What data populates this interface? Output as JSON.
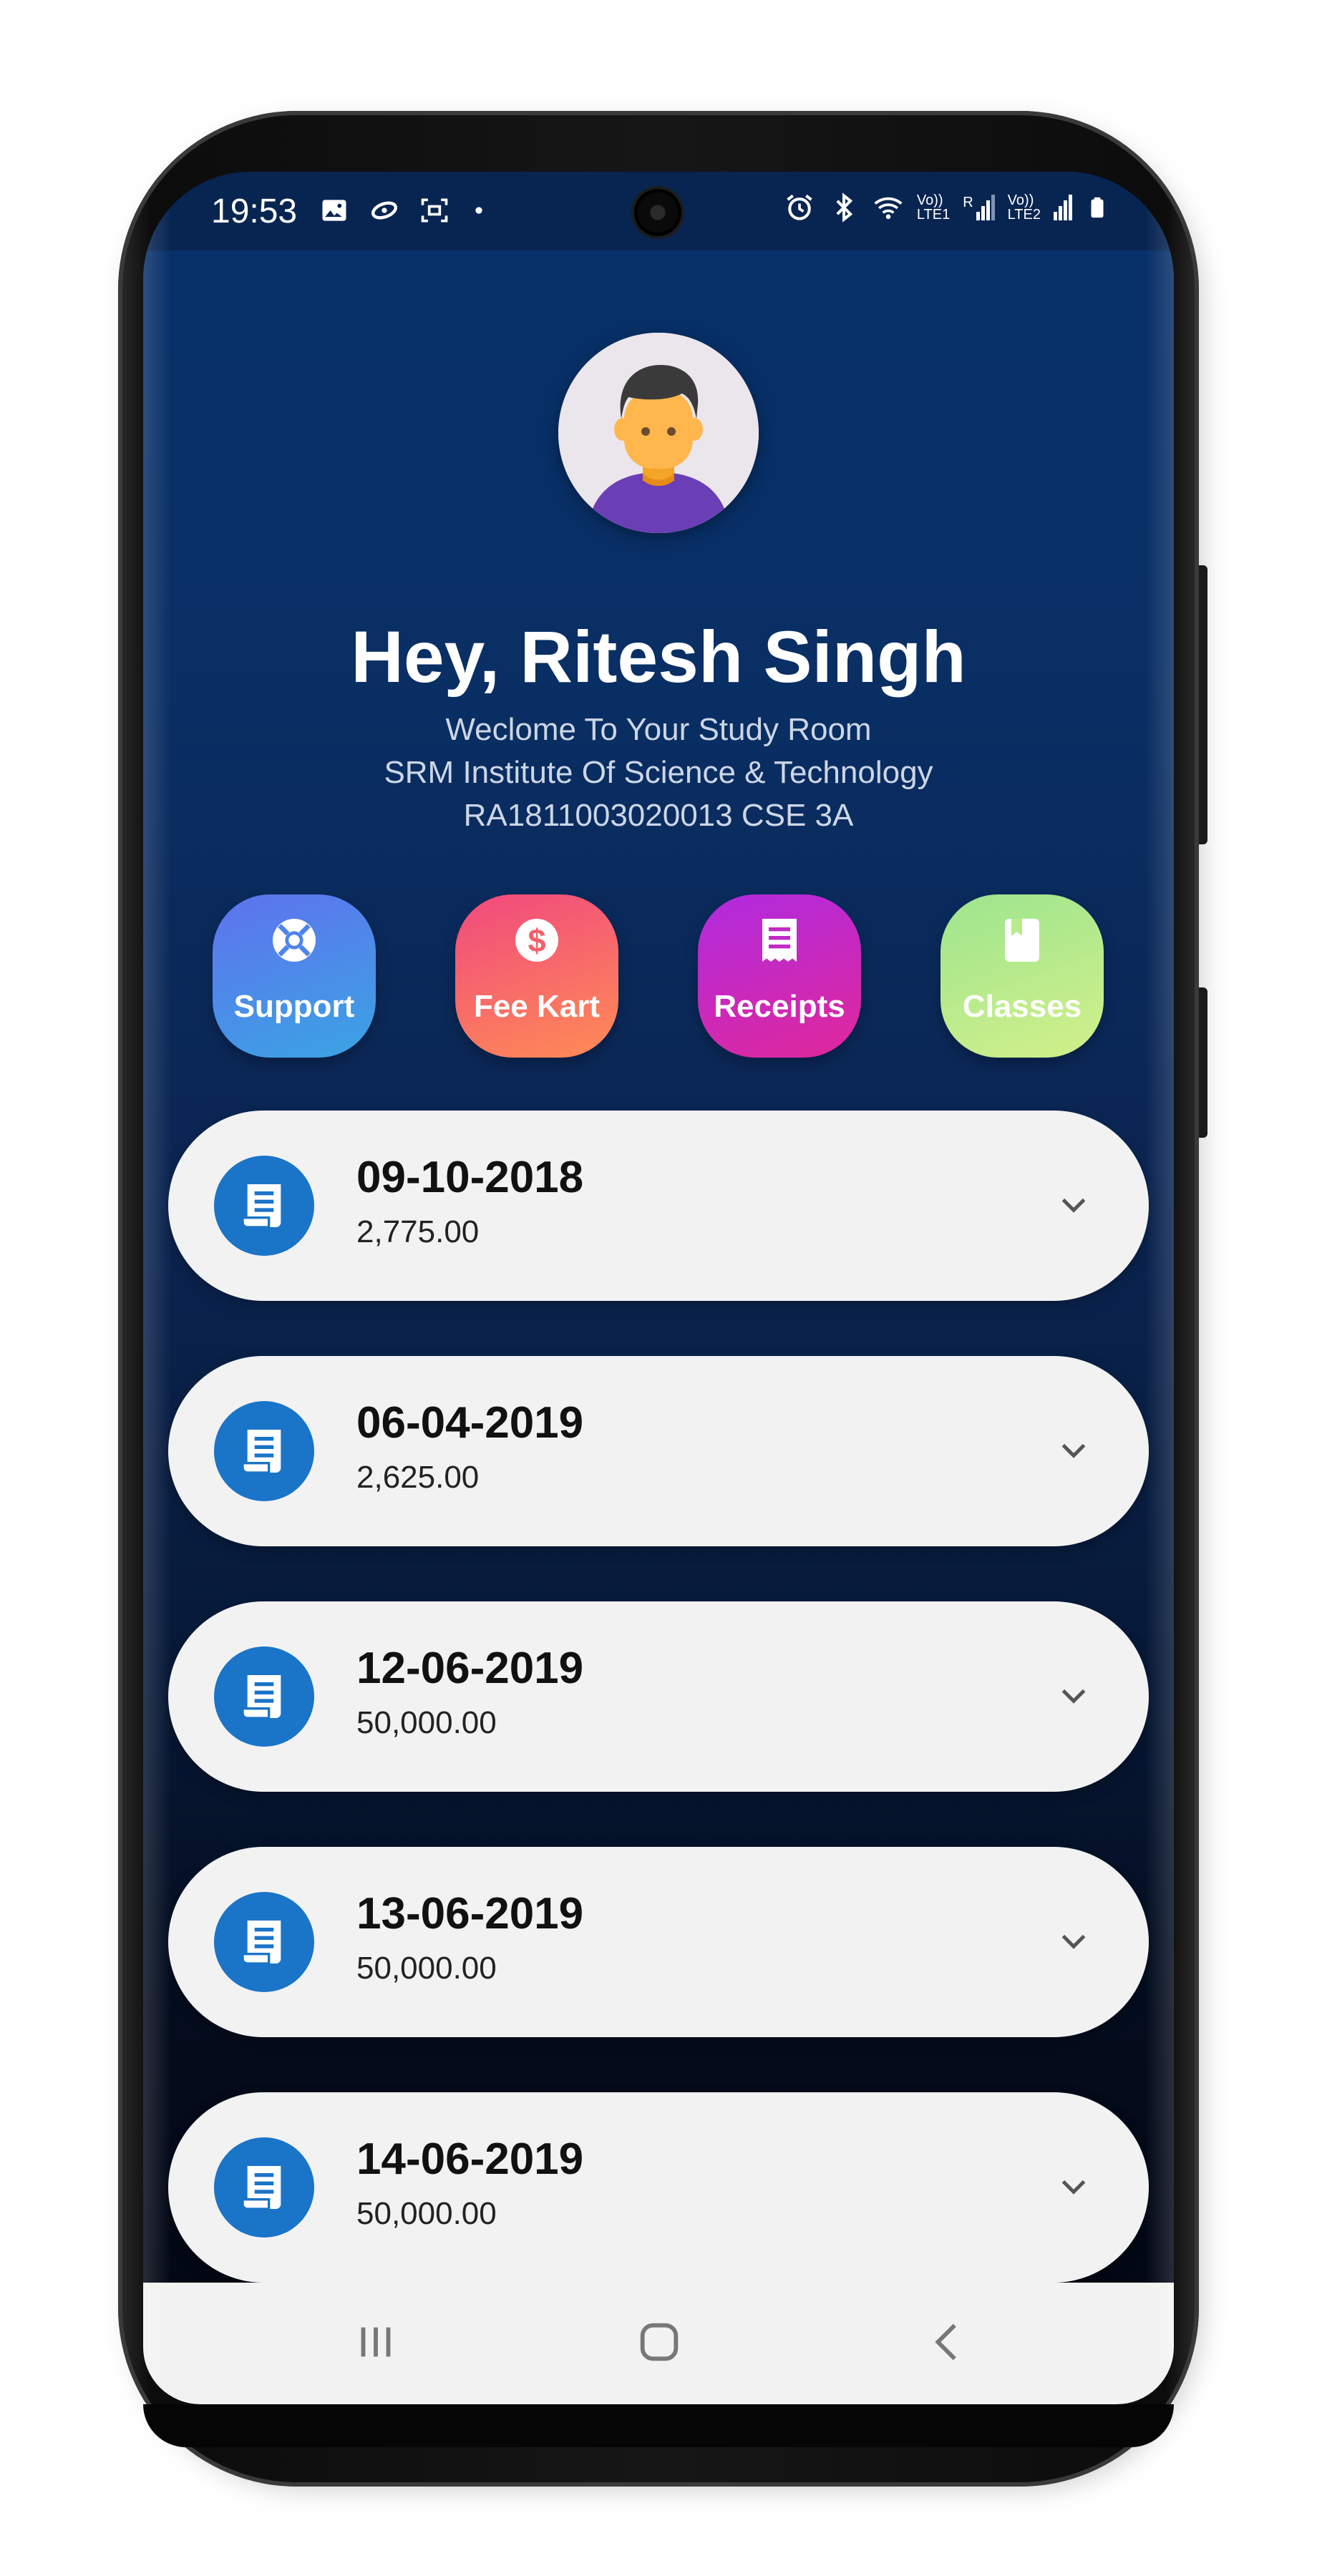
{
  "status_bar": {
    "time": "19:53",
    "left_icons": [
      "image-icon",
      "sync-icon",
      "screenshot-icon",
      "dot-icon"
    ],
    "right_icons": [
      "alarm-icon",
      "bluetooth-icon",
      "wifi-icon",
      "signal-sim1-icon",
      "signal-sim2-icon",
      "battery-icon"
    ],
    "sim1_label_top": "Vo))",
    "sim1_label_bottom": "LTE1",
    "sim1_roaming": "R",
    "sim2_label_top": "Vo))",
    "sim2_label_bottom": "LTE2"
  },
  "profile": {
    "avatar_icon": "user-avatar-icon",
    "greeting": "Hey, Ritesh Singh",
    "welcome": "Weclome To Your Study Room",
    "institute": "SRM Institute Of Science & Technology",
    "student_info": "RA1811003020013 CSE 3A"
  },
  "actions": [
    {
      "label": "Support",
      "icon": "lifebuoy-icon"
    },
    {
      "label": "Fee Kart",
      "icon": "dollar-icon"
    },
    {
      "label": "Receipts",
      "icon": "receipt-icon"
    },
    {
      "label": "Classes",
      "icon": "book-icon"
    }
  ],
  "receipts": [
    {
      "date": "09-10-2018",
      "amount": "2,775.00"
    },
    {
      "date": "06-04-2019",
      "amount": "2,625.00"
    },
    {
      "date": "12-06-2019",
      "amount": "50,000.00"
    },
    {
      "date": "13-06-2019",
      "amount": "50,000.00"
    },
    {
      "date": "14-06-2019",
      "amount": "50,000.00"
    }
  ],
  "nav": {
    "icons": [
      "recents-icon",
      "home-icon",
      "back-icon"
    ]
  },
  "colors": {
    "background_top": "#073069",
    "background_bottom": "#020510",
    "card": "#f2f2f2",
    "receipt_icon_bg": "#1a74c8",
    "support": "#5f72ee",
    "fee_kart": "#f0497e",
    "receipts": "#b02ae0",
    "classes": "#9ee58e"
  }
}
